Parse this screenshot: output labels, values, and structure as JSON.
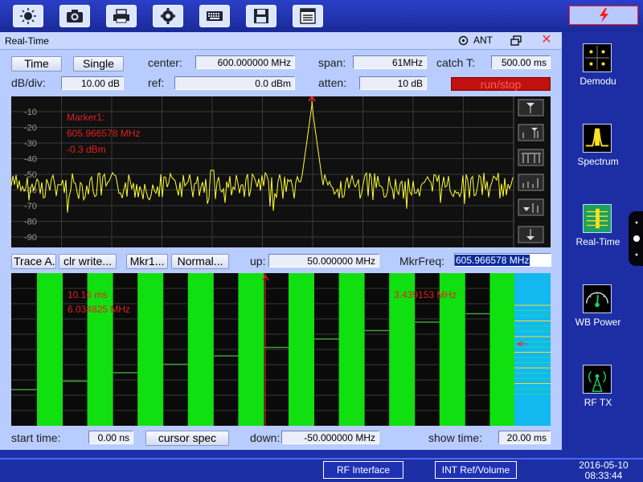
{
  "toolbar": {
    "icons": [
      "brightness-icon",
      "camera-icon",
      "printer-icon",
      "settings-gear-icon",
      "keyboard-icon",
      "save-disk-icon",
      "document-list-icon"
    ]
  },
  "window": {
    "title": "Real-Time",
    "ant_label": "ANT"
  },
  "controls": {
    "time_button": "Time",
    "single_button": "Single",
    "center_label": "center:",
    "center_value": "600.000000 MHz",
    "span_label": "span:",
    "span_value": "61MHz",
    "catch_label": "catch T:",
    "catch_value": "500.00 ms",
    "dbdiv_label": "dB/div:",
    "dbdiv_value": "10.00 dB",
    "ref_label": "ref:",
    "ref_value": "0.0 dBm",
    "atten_label": "atten:",
    "atten_value": "10 dB",
    "runstop_label": "run/stop"
  },
  "spectrum": {
    "marker_title": "Marker1:",
    "marker_freq": "605.966578 MHz",
    "marker_level": "-0.3 dBm",
    "y_ticks": [
      "-10",
      "-20",
      "-30",
      "-40",
      "-50",
      "-60",
      "-70",
      "-80",
      "-90"
    ]
  },
  "midrow": {
    "trace_button": "Trace A...",
    "clear_button": "clr write...",
    "marker_button": "Mkr1...",
    "normal_button": "Normal...",
    "up_label": "up:",
    "up_value": "50.000000 MHz",
    "mkrfreq_label": "MkrFreq:",
    "mkrfreq_value": "605.966578 MHz"
  },
  "waterfall": {
    "left_time": "10.16 ms",
    "left_freq": "6.034825 MHz",
    "right_freq": "3.439153 MHz"
  },
  "bottomrow": {
    "start_label": "start time:",
    "start_value": "0.00 ns",
    "cursor_button": "cursor spec",
    "down_label": "down:",
    "down_value": "-50.000000 MHz",
    "show_label": "show time:",
    "show_value": "20.00 ms"
  },
  "sidebar": {
    "items": [
      {
        "label": "Demodu",
        "icon": "demodulation-icon"
      },
      {
        "label": "Spectrum",
        "icon": "spectrum-icon"
      },
      {
        "label": "Real-Time",
        "icon": "realtime-icon"
      },
      {
        "label": "WB Power",
        "icon": "power-meter-icon"
      },
      {
        "label": "RF TX",
        "icon": "antenna-icon"
      }
    ]
  },
  "bottombar": {
    "rf_interface": "RF Interface",
    "int_ref": "INT Ref/Volume",
    "date": "2016-05-10",
    "time": "08:33:44"
  },
  "colors": {
    "trace": "#ffff33",
    "marker": "#ff2020",
    "waterfall_band": "#10e010",
    "waterfall_level": "#3ca03c",
    "grid": "#3a3a3a"
  }
}
